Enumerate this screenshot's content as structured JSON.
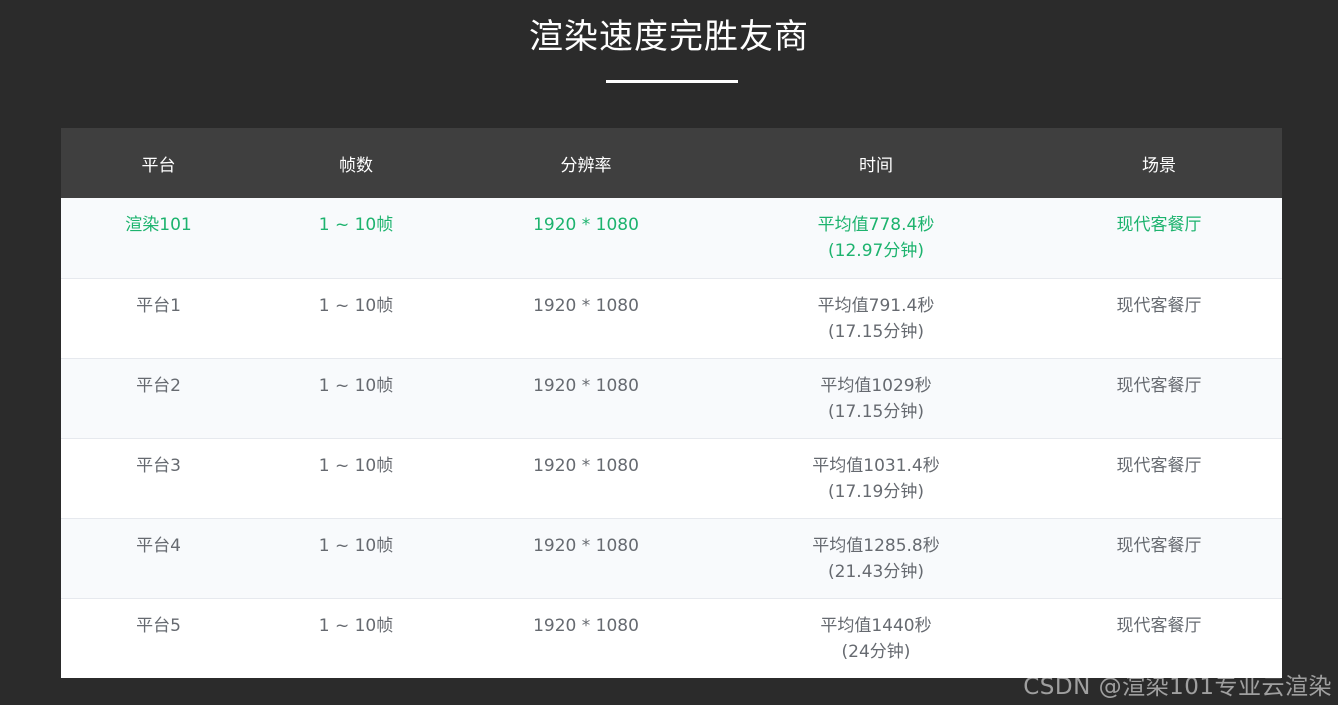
{
  "page": {
    "title": "渲染速度完胜友商",
    "accent_color": "#1db36e",
    "header_bg": "#3f3f3f",
    "page_bg": "#2b2b2b"
  },
  "table": {
    "headers": [
      "平台",
      "帧数",
      "分辨率",
      "时间",
      "场景"
    ],
    "rows": [
      {
        "platform": "渲染101",
        "frames": "1 ~ 10帧",
        "resolution": "1920 * 1080",
        "time_avg": "平均值778.4秒",
        "time_min": "(12.97分钟)",
        "scene": "现代客餐厅",
        "highlight": true
      },
      {
        "platform": "平台1",
        "frames": "1 ~ 10帧",
        "resolution": "1920 * 1080",
        "time_avg": "平均值791.4秒",
        "time_min": "(17.15分钟)",
        "scene": "现代客餐厅",
        "highlight": false
      },
      {
        "platform": "平台2",
        "frames": "1 ~ 10帧",
        "resolution": "1920 * 1080",
        "time_avg": "平均值1029秒",
        "time_min": "(17.15分钟)",
        "scene": "现代客餐厅",
        "highlight": false
      },
      {
        "platform": "平台3",
        "frames": "1 ~ 10帧",
        "resolution": "1920 * 1080",
        "time_avg": "平均值1031.4秒",
        "time_min": "(17.19分钟)",
        "scene": "现代客餐厅",
        "highlight": false
      },
      {
        "platform": "平台4",
        "frames": "1 ~ 10帧",
        "resolution": "1920 * 1080",
        "time_avg": "平均值1285.8秒",
        "time_min": "(21.43分钟)",
        "scene": "现代客餐厅",
        "highlight": false
      },
      {
        "platform": "平台5",
        "frames": "1 ~ 10帧",
        "resolution": "1920 * 1080",
        "time_avg": "平均值1440秒",
        "time_min": "(24分钟)",
        "scene": "现代客餐厅",
        "highlight": false
      }
    ]
  },
  "watermark": "CSDN @渲染101专业云渲染"
}
